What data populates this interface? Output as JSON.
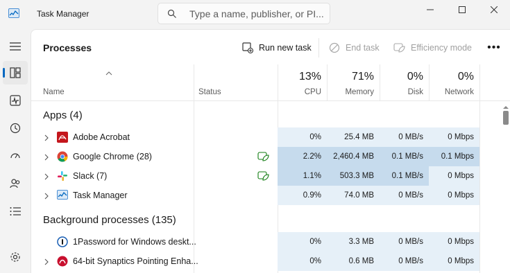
{
  "window": {
    "title": "Task Manager"
  },
  "search": {
    "placeholder": "Type a name, publisher, or PI..."
  },
  "toolbar": {
    "page_title": "Processes",
    "run_new_task": "Run new task",
    "end_task": "End task",
    "efficiency_mode": "Efficiency mode",
    "more": "•••"
  },
  "columns": {
    "name": "Name",
    "status": "Status",
    "cpu": {
      "pct": "13%",
      "label": "CPU"
    },
    "memory": {
      "pct": "71%",
      "label": "Memory"
    },
    "disk": {
      "pct": "0%",
      "label": "Disk"
    },
    "network": {
      "pct": "0%",
      "label": "Network"
    }
  },
  "sections": {
    "apps": "Apps (4)",
    "background": "Background processes (135)"
  },
  "rows": [
    {
      "name": "Adobe Acrobat",
      "icon": "acrobat-icon",
      "expandable": true,
      "efficiency": false,
      "cpu": "0%",
      "memory": "25.4 MB",
      "disk": "0 MB/s",
      "network": "0 Mbps"
    },
    {
      "name": "Google Chrome (28)",
      "icon": "chrome-icon",
      "expandable": true,
      "efficiency": true,
      "cpu": "2.2%",
      "memory": "2,460.4 MB",
      "disk": "0.1 MB/s",
      "network": "0.1 Mbps"
    },
    {
      "name": "Slack (7)",
      "icon": "slack-icon",
      "expandable": true,
      "efficiency": true,
      "cpu": "1.1%",
      "memory": "503.3 MB",
      "disk": "0.1 MB/s",
      "network": "0 Mbps"
    },
    {
      "name": "Task Manager",
      "icon": "task-manager-icon",
      "expandable": true,
      "efficiency": false,
      "cpu": "0.9%",
      "memory": "74.0 MB",
      "disk": "0 MB/s",
      "network": "0 Mbps"
    },
    {
      "name": "1Password for Windows deskt...",
      "icon": "1password-icon",
      "expandable": false,
      "efficiency": false,
      "cpu": "0%",
      "memory": "3.3 MB",
      "disk": "0 MB/s",
      "network": "0 Mbps"
    },
    {
      "name": "64-bit Synaptics Pointing Enha...",
      "icon": "synaptics-icon",
      "expandable": true,
      "efficiency": false,
      "cpu": "0%",
      "memory": "0.6 MB",
      "disk": "0 MB/s",
      "network": "0 Mbps"
    }
  ],
  "colors": {
    "heat_low": "#e6f0f8",
    "heat_mid": "#c6dbed",
    "accent": "#0067c0",
    "efficiency_green": "#107c10"
  }
}
